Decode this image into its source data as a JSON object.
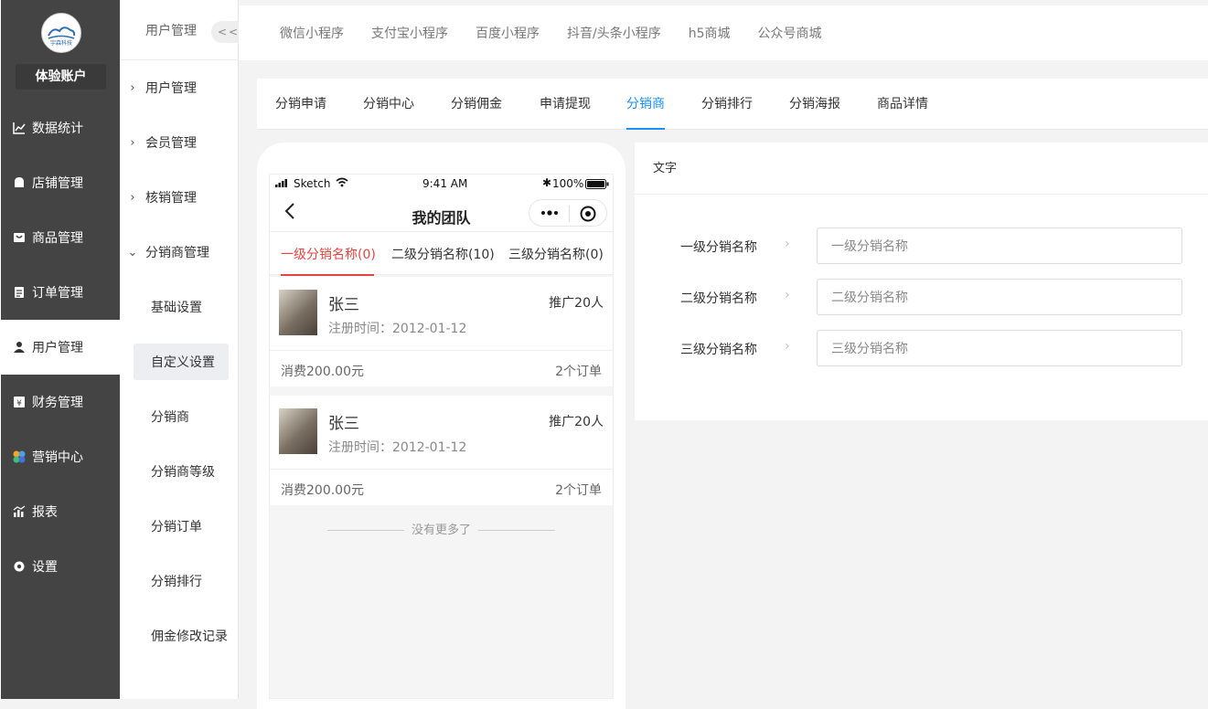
{
  "sidebar": {
    "logo_text": "宇森科技",
    "account": "体验账户",
    "items": [
      {
        "label": "数据统计",
        "icon": "chart-icon"
      },
      {
        "label": "店铺管理",
        "icon": "shop-icon"
      },
      {
        "label": "商品管理",
        "icon": "goods-icon"
      },
      {
        "label": "订单管理",
        "icon": "order-icon"
      },
      {
        "label": "用户管理",
        "icon": "user-icon"
      },
      {
        "label": "财务管理",
        "icon": "finance-icon"
      },
      {
        "label": "营销中心",
        "icon": "marketing-icon"
      },
      {
        "label": "报表",
        "icon": "report-icon"
      },
      {
        "label": "设置",
        "icon": "settings-icon"
      }
    ]
  },
  "subsidebar": {
    "title": "用户管理",
    "collapse": "<<",
    "groups": [
      "用户管理",
      "会员管理",
      "核销管理",
      "分销商管理"
    ],
    "leaves": [
      "基础设置",
      "自定义设置",
      "分销商",
      "分销商等级",
      "分销订单",
      "分销排行",
      "佣金修改记录"
    ]
  },
  "topbar": {
    "items": [
      "微信小程序",
      "支付宝小程序",
      "百度小程序",
      "抖音/头条小程序",
      "h5商城",
      "公众号商城"
    ]
  },
  "tabs": [
    "分销申请",
    "分销中心",
    "分销佣金",
    "申请提现",
    "分销商",
    "分销排行",
    "分销海报",
    "商品详情"
  ],
  "phone": {
    "carrier": "Sketch",
    "time": "9:41 AM",
    "battery": "100%",
    "title": "我的团队",
    "levels": [
      "一级分销名称(0)",
      "二级分销名称(10)",
      "三级分销名称(0)"
    ],
    "cards": [
      {
        "name": "张三",
        "reg": "注册时间：2012-01-12",
        "promo": "推广20人",
        "spend": "消费200.00元",
        "orders": "2个订单"
      },
      {
        "name": "张三",
        "reg": "注册时间：2012-01-12",
        "promo": "推广20人",
        "spend": "消费200.00元",
        "orders": "2个订单"
      }
    ],
    "no_more": "没有更多了"
  },
  "panel": {
    "title": "文字",
    "rows": [
      {
        "label": "一级分销名称",
        "placeholder": "一级分销名称"
      },
      {
        "label": "二级分销名称",
        "placeholder": "二级分销名称"
      },
      {
        "label": "三级分销名称",
        "placeholder": "三级分销名称"
      }
    ]
  },
  "colors": {
    "accent": "#1890ff",
    "phone_accent": "#e64340",
    "sidebar_bg": "#444444"
  }
}
